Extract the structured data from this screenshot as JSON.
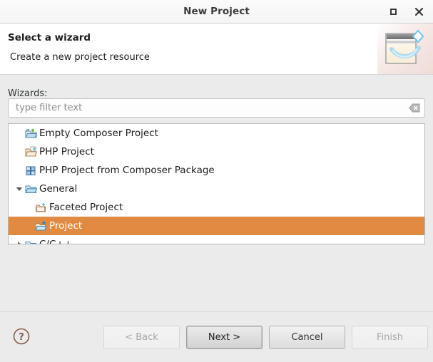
{
  "window": {
    "title": "New Project",
    "maximize_label": "Maximize",
    "close_label": "Close"
  },
  "header": {
    "title": "Select a wizard",
    "subtitle": "Create a new project resource",
    "banner_icon": "new-project-wizard-icon"
  },
  "body": {
    "wizards_label": "Wizards:",
    "filter": {
      "value": "",
      "placeholder": "type filter text",
      "clear_icon": "clear-icon"
    },
    "tree": [
      {
        "label": "Empty Composer Project",
        "icon": "composer-project-icon",
        "level": 0,
        "arrow": "none",
        "selected": false
      },
      {
        "label": "PHP Project",
        "icon": "php-project-icon",
        "level": 0,
        "arrow": "none",
        "selected": false
      },
      {
        "label": "PHP Project from Composer Package",
        "icon": "composer-package-icon",
        "level": 0,
        "arrow": "none",
        "selected": false
      },
      {
        "label": "General",
        "icon": "folder-open-icon",
        "level": 0,
        "arrow": "expanded",
        "selected": false
      },
      {
        "label": "Faceted Project",
        "icon": "faceted-project-icon",
        "level": 1,
        "arrow": "none",
        "selected": false
      },
      {
        "label": "Project",
        "icon": "new-project-icon",
        "level": 1,
        "arrow": "none",
        "selected": true
      },
      {
        "label": "C/C++",
        "icon": "folder-closed-icon",
        "level": 0,
        "arrow": "collapsed",
        "selected": false
      }
    ]
  },
  "footer": {
    "help_icon": "help-icon",
    "buttons": [
      {
        "label": "< Back",
        "state": "disabled",
        "name": "back-button"
      },
      {
        "label": "Next >",
        "state": "focused",
        "name": "next-button"
      },
      {
        "label": "Cancel",
        "state": "enabled",
        "name": "cancel-button"
      },
      {
        "label": "Finish",
        "state": "disabled",
        "name": "finish-button"
      }
    ]
  },
  "colors": {
    "selection": "#e08b41",
    "dialog_bg": "#ebebeb",
    "titlebar_bg": "#f7f7f7",
    "header_bg": "#ffffff",
    "list_bg": "#ffffff",
    "text": "#1c1c1c",
    "placeholder": "#8d8d8d",
    "help_icon": "#8a5a46"
  }
}
